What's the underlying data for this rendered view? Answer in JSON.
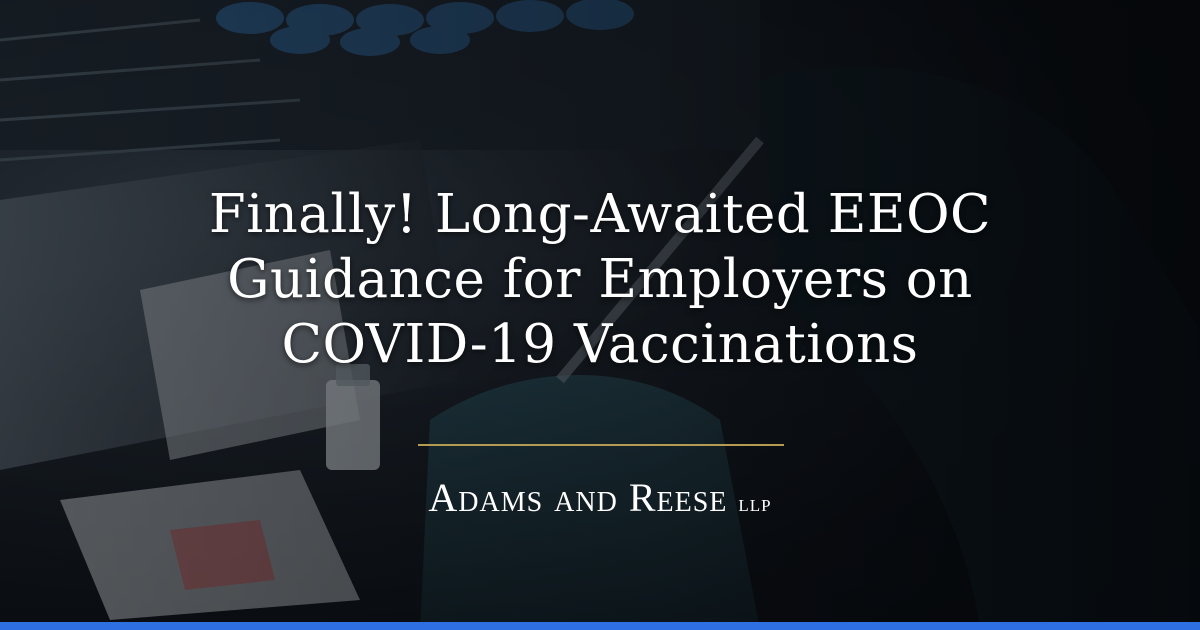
{
  "headline": {
    "line1": "Finally! Long-Awaited EEOC",
    "line2": "Guidance for Employers on",
    "line3": "COVID-19 Vaccinations"
  },
  "logo": {
    "name": "Adams and Reese",
    "suffix": "llp"
  },
  "colors": {
    "divider": "#b59a52",
    "bottom_bar": "#2f6fe4",
    "text": "#ffffff"
  }
}
